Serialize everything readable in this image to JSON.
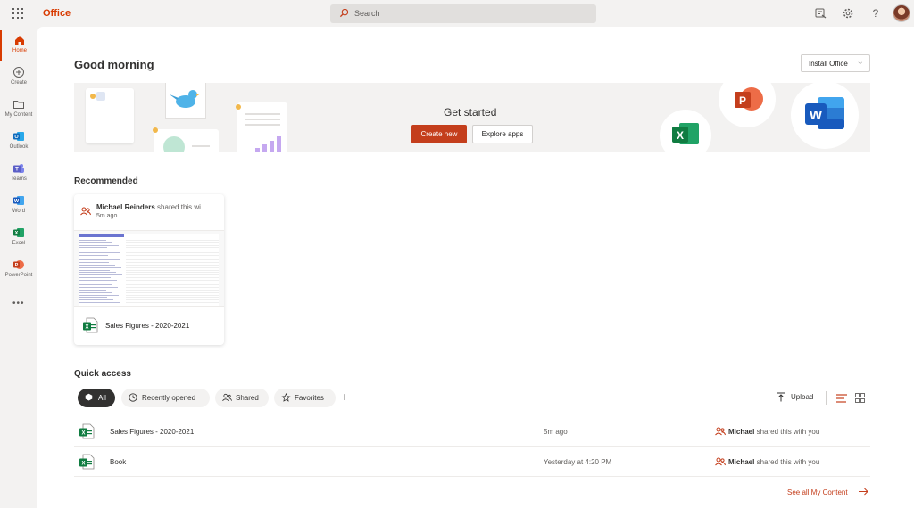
{
  "topbar": {
    "app_name": "Office",
    "search_placeholder": "Search",
    "help_label": "?"
  },
  "rail": {
    "items": [
      {
        "label": "Home"
      },
      {
        "label": "Create"
      },
      {
        "label": "My Content"
      },
      {
        "label": "Outlook"
      },
      {
        "label": "Teams"
      },
      {
        "label": "Word"
      },
      {
        "label": "Excel"
      },
      {
        "label": "PowerPoint"
      }
    ],
    "more_label": "•••"
  },
  "main": {
    "greeting": "Good morning",
    "install_label": "Install Office",
    "banner": {
      "title": "Get started",
      "create_new_label": "Create new",
      "explore_apps_label": "Explore apps",
      "app_letters": {
        "powerpoint": "P",
        "word": "W",
        "excel": "X"
      }
    },
    "recommended": {
      "title": "Recommended",
      "card": {
        "sharer": "Michael Reinders",
        "action": "shared this wi...",
        "time": "5m ago",
        "file_name": "Sales Figures - 2020-2021"
      }
    },
    "quick_access": {
      "title": "Quick access",
      "filters": [
        {
          "label": "All"
        },
        {
          "label": "Recently opened"
        },
        {
          "label": "Shared"
        },
        {
          "label": "Favorites"
        }
      ],
      "add_label": "+",
      "upload_label": "Upload",
      "rows": [
        {
          "name": "Sales Figures - 2020-2021",
          "time": "5m ago",
          "sharer": "Michael",
          "action": "shared this with you"
        },
        {
          "name": "Book",
          "time": "Yesterday at 4:20 PM",
          "sharer": "Michael",
          "action": "shared this with you"
        }
      ],
      "see_all_label": "See all My Content"
    }
  },
  "colors": {
    "accent": "#c43e1c",
    "brand": "#d83b01",
    "excel": "#107c41",
    "word": "#185abd",
    "powerpoint": "#c43e1c",
    "outlook": "#0f6cbd",
    "teams": "#5b5fc7"
  }
}
